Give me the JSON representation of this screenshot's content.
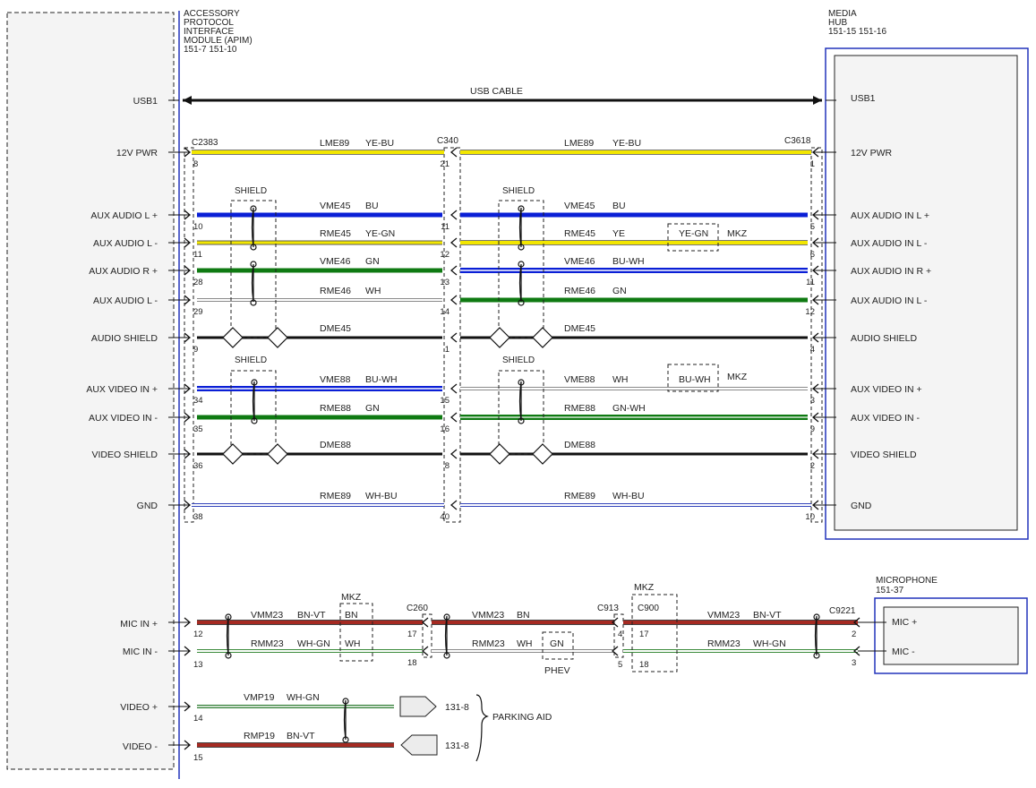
{
  "modules": {
    "apim": {
      "title_lines": [
        "ACCESSORY",
        "PROTOCOL",
        "INTERFACE",
        "MODULE (APIM)",
        "151-7   151-10"
      ],
      "pins": [
        "USB1",
        "12V PWR",
        "AUX AUDIO L +",
        "AUX AUDIO L -",
        "AUX AUDIO R +",
        "AUX AUDIO L -",
        "AUDIO SHIELD",
        "AUX VIDEO IN +",
        "AUX VIDEO IN -",
        "VIDEO SHIELD",
        "GND",
        "MIC IN +",
        "MIC IN -",
        "VIDEO +",
        "VIDEO -"
      ]
    },
    "media_hub": {
      "title_lines": [
        "MEDIA",
        "HUB",
        "151-15  151-16"
      ],
      "pins": [
        "USB1",
        "12V PWR",
        "AUX AUDIO IN L +",
        "AUX AUDIO IN L -",
        "AUX AUDIO IN R +",
        "AUX AUDIO IN L -",
        "AUDIO SHIELD",
        "AUX VIDEO IN +",
        "AUX VIDEO IN -",
        "VIDEO SHIELD",
        "GND"
      ]
    },
    "microphone": {
      "title_lines": [
        "MICROPHONE",
        "151-37"
      ],
      "pins": [
        "MIC +",
        "MIC -"
      ]
    }
  },
  "usb_cable_label": "USB CABLE",
  "shield_label": "SHIELD",
  "connectors": {
    "c2383": "C2383",
    "c340": "C340",
    "c3618": "C3618",
    "c260": "C260",
    "c913": "C913",
    "c900": "C900",
    "c9221": "C9221"
  },
  "wires_left": [
    {
      "circuit": "LME89",
      "color": "YE-BU",
      "pin_a": "8",
      "pin_b": "21"
    },
    {
      "circuit": "VME45",
      "color": "BU",
      "pin_a": "10",
      "pin_b": "11"
    },
    {
      "circuit": "RME45",
      "color": "YE-GN",
      "pin_a": "11",
      "pin_b": "12"
    },
    {
      "circuit": "VME46",
      "color": "GN",
      "pin_a": "28",
      "pin_b": "13"
    },
    {
      "circuit": "RME46",
      "color": "WH",
      "pin_a": "29",
      "pin_b": "14"
    },
    {
      "circuit": "DME45",
      "color": "",
      "pin_a": "9",
      "pin_b": "1"
    },
    {
      "circuit": "VME88",
      "color": "BU-WH",
      "pin_a": "34",
      "pin_b": "15"
    },
    {
      "circuit": "RME88",
      "color": "GN",
      "pin_a": "35",
      "pin_b": "16"
    },
    {
      "circuit": "DME88",
      "color": "",
      "pin_a": "36",
      "pin_b": "8"
    },
    {
      "circuit": "RME89",
      "color": "WH-BU",
      "pin_a": "38",
      "pin_b": "40"
    }
  ],
  "wires_right": [
    {
      "circuit": "LME89",
      "color": "YE-BU",
      "pin": "1"
    },
    {
      "circuit": "VME45",
      "color": "BU",
      "pin": "5"
    },
    {
      "circuit": "RME45",
      "color": "YE",
      "pin": "6"
    },
    {
      "circuit": "VME46",
      "color": "BU-WH",
      "pin": "11"
    },
    {
      "circuit": "RME46",
      "color": "GN",
      "pin": "12"
    },
    {
      "circuit": "DME45",
      "color": "",
      "pin": "4"
    },
    {
      "circuit": "VME88",
      "color": "WH",
      "pin": "3"
    },
    {
      "circuit": "RME88",
      "color": "GN-WH",
      "pin": "9"
    },
    {
      "circuit": "DME88",
      "color": "",
      "pin": "2"
    },
    {
      "circuit": "RME89",
      "color": "WH-BU",
      "pin": "10"
    }
  ],
  "variants": {
    "mkz": "MKZ",
    "phev": "PHEV",
    "yegn": "YE-GN",
    "buwh": "BU-WH",
    "bn": "BN",
    "wh": "WH",
    "gn": "GN"
  },
  "mic_wires": [
    {
      "circuit": "VMM23",
      "c1": "BN-VT",
      "c2": "BN",
      "c3": "BN-VT",
      "p_apim": "12",
      "p_c260": "17",
      "p_c913": "4",
      "p_c900": "17",
      "p_c9221": "2"
    },
    {
      "circuit": "RMM23",
      "c1": "WH-GN",
      "c2": "WH",
      "c3": "WH-GN",
      "p_apim": "13",
      "p_c260": "18",
      "p_c913": "5",
      "p_c900": "18",
      "p_c9221": "3"
    }
  ],
  "parking_wires": [
    {
      "circuit": "VMP19",
      "color": "WH-GN",
      "pin": "14",
      "dest": "131-8"
    },
    {
      "circuit": "RMP19",
      "color": "BN-VT",
      "pin": "15",
      "dest": "131-8"
    }
  ],
  "parking_aid_label": "PARKING AID",
  "wire_colors": {
    "yellow": "#f2e600",
    "blue": "#0a1fd6",
    "green": "#0f7a12",
    "black": "#111111",
    "white_edge": "#7f7f7f",
    "brown_red": "#a52a22",
    "module_border": "#2233bb"
  }
}
